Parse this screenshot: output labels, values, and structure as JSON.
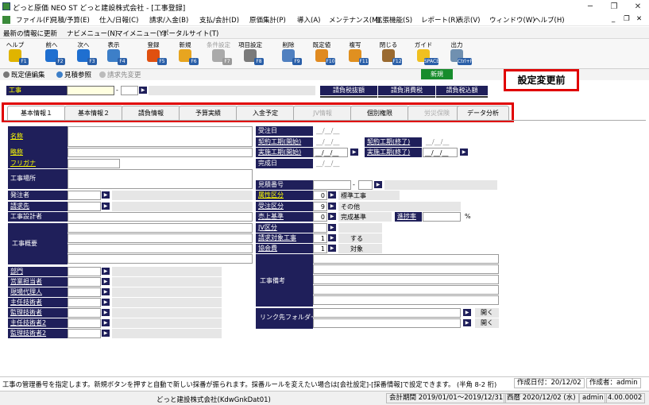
{
  "window": {
    "title": "どっと原価 NEO ST どっと建設株式会社 - [工事登録]",
    "minimize": "─",
    "restore": "❐",
    "close": "✕"
  },
  "menubar": {
    "items": [
      "ファイル(F)",
      "見積/予算(E)",
      "仕入/日報(C)",
      "請求/入金(B)",
      "支払/会計(D)",
      "原価集計(P)",
      "導入(A)",
      "メンテナンス(M)",
      "拡張機能(S)",
      "レポート(R)",
      "表示(V)",
      "ウィンドウ(W)",
      "ヘルプ(H)"
    ],
    "inner_controls": [
      "_",
      "❐",
      "✕"
    ]
  },
  "subbar": {
    "items": [
      "最新の情報に更新",
      "ナビメニュー(N)",
      "マイメニュー(Y)",
      "ポータルサイト(T)"
    ]
  },
  "toolbar": {
    "buttons": [
      {
        "label": "ヘルプ",
        "key": "F1",
        "icon": "help-icon",
        "color": "#e0b400",
        "enabled": true
      },
      {
        "label": "前へ",
        "key": "F2",
        "icon": "arrow-left-icon",
        "color": "#1f6fd0",
        "enabled": true
      },
      {
        "label": "次へ",
        "key": "F3",
        "icon": "arrow-right-icon",
        "color": "#1f6fd0",
        "enabled": true
      },
      {
        "label": "表示",
        "key": "F4",
        "icon": "magnifier-icon",
        "color": "#3d7fc8",
        "enabled": true
      },
      {
        "label": "登録",
        "key": "F5",
        "icon": "ok-icon",
        "color": "#e05010",
        "enabled": true
      },
      {
        "label": "新規",
        "key": "F6",
        "icon": "new-document-icon",
        "color": "#e7a520",
        "enabled": true
      },
      {
        "label": "条件設定",
        "key": "F7",
        "icon": "search-settings-icon",
        "color": "#aaaaaa",
        "enabled": false
      },
      {
        "label": "項目設定",
        "key": "F8",
        "icon": "gears-icon",
        "color": "#7a7a7a",
        "enabled": true
      },
      {
        "label": "削除",
        "key": "F9",
        "icon": "eraser-icon",
        "color": "#5080c0",
        "enabled": true
      },
      {
        "label": "既定値",
        "key": "F10",
        "icon": "reset-icon",
        "color": "#e08a20",
        "enabled": true
      },
      {
        "label": "複写",
        "key": "F11",
        "icon": "copy-icon",
        "color": "#e09020",
        "enabled": true
      },
      {
        "label": "閉じる",
        "key": "F12",
        "icon": "door-icon",
        "color": "#9a6a30",
        "enabled": true
      },
      {
        "label": "ガイド",
        "key": "SPACE",
        "icon": "bulb-icon",
        "color": "#f0c020",
        "enabled": true
      },
      {
        "label": "出力",
        "key": "Ctrl+P",
        "icon": "print-icon",
        "color": "#7090b0",
        "enabled": true
      }
    ]
  },
  "row3": {
    "preset_edit": "既定値編集",
    "estimate_ref": "見積参照",
    "billing_ref": "請求先変更"
  },
  "header": {
    "koji_label": "工事",
    "koji_value": "",
    "dash": "-",
    "sub_value": "",
    "new_badge": "新規"
  },
  "contract_table": {
    "headers": [
      "請負税抜額",
      "請負消費税",
      "請負税込額"
    ],
    "values": [
      "",
      "",
      ""
    ]
  },
  "callout": "設定変更前",
  "tabs": [
    {
      "label": "基本情報１",
      "active": true,
      "enabled": true
    },
    {
      "label": "基本情報２",
      "active": false,
      "enabled": true
    },
    {
      "label": "請負情報",
      "active": false,
      "enabled": true
    },
    {
      "label": "予算実績",
      "active": false,
      "enabled": true
    },
    {
      "label": "入金予定",
      "active": false,
      "enabled": true
    },
    {
      "label": "JV情報",
      "active": false,
      "enabled": false
    },
    {
      "label": "個別権限",
      "active": false,
      "enabled": true
    },
    {
      "label": "労災保険",
      "active": false,
      "enabled": false
    },
    {
      "label": "データ分析",
      "active": false,
      "enabled": true
    }
  ],
  "form": {
    "name": "名称",
    "short_name": "略称",
    "furigana": "フリガナ",
    "site": "工事場所",
    "orderer": "発注者",
    "billing": "請求先",
    "designer": "工事設計者",
    "overview": "工事概要",
    "dept": "部門",
    "sales": "営業担当者",
    "agent": "現場代理人",
    "chief": "主任技術者",
    "supervisor": "監理技術者",
    "chief2": "主任技術者2",
    "supervisor2": "監理技術者2",
    "order_date": "受注日",
    "contract_start": "契約工期(開始)",
    "contract_end": "契約工期(終了)",
    "actual_start": "実施工期(開始)",
    "actual_end": "実施工期(終了)",
    "completion": "完成日",
    "date_placeholder": "__/__/__",
    "estimate_no": "見積番号",
    "attr": "属性区分",
    "attr_code": "0",
    "attr_name": "標準工事",
    "order_kind": "受注区分",
    "order_code": "9",
    "order_name": "その他",
    "sales_basis": "売上基準",
    "sales_code": "0",
    "sales_name": "完成基準",
    "progress": "進捗率",
    "percent": "%",
    "jv": "JV区分",
    "billing_target": "請求対象工事",
    "billing_code": "1",
    "billing_name": "する",
    "assoc_fee": "協会費",
    "assoc_code": "1",
    "assoc_name": "対象",
    "notes": "工事備考",
    "link_folder": "リンク先フォルダー",
    "open": "開く"
  },
  "status": {
    "message": "工事の管理番号を指定します。新規ボタンを押すと自動で新しい採番が振られます。採番ルールを変えたい場合は[会社設定]-[採番情報]で設定できます。 (半角 8-2 桁)",
    "created": "作成日付：20/12/02",
    "author": "作成者：admin",
    "company": "どっと建設株式会社(KdwGnkDat01)",
    "period": "会計期間 2019/01/01～2019/12/31",
    "date": "西暦 2020/12/02 (水)",
    "user": "admin",
    "version": "4.00.0002"
  }
}
